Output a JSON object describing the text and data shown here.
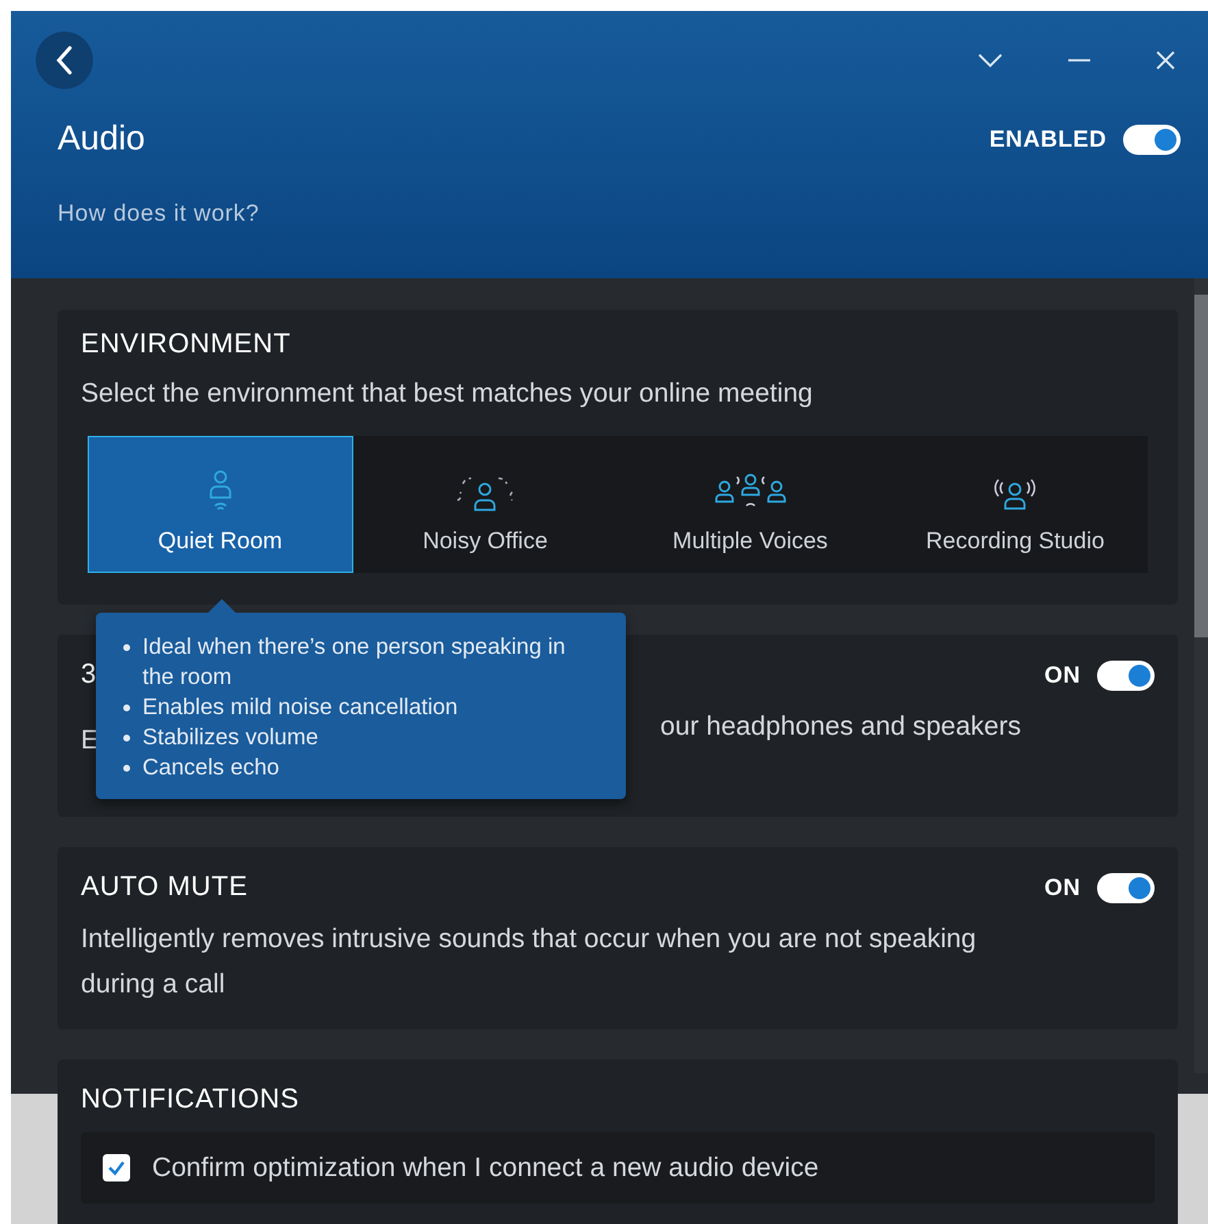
{
  "header": {
    "title": "Audio",
    "link": "How does it work?",
    "enabled": {
      "label": "ENABLED",
      "on": true
    }
  },
  "environment": {
    "title": "ENVIRONMENT",
    "description": "Select the environment that best matches your online meeting",
    "options": [
      {
        "label": "Quiet Room",
        "kind": "quiet",
        "selected": true
      },
      {
        "label": "Noisy Office",
        "kind": "noisy",
        "selected": false
      },
      {
        "label": "Multiple Voices",
        "kind": "multiple",
        "selected": false
      },
      {
        "label": "Recording Studio",
        "kind": "studio",
        "selected": false
      }
    ],
    "tooltip": [
      "Ideal when there’s one person speaking in the room",
      "Enables mild noise cancellation",
      "Stabilizes volume",
      "Cancels echo"
    ]
  },
  "settings": [
    {
      "title": "3",
      "description_start": "E",
      "description_end": "our headphones and speakers",
      "toggle": {
        "label": "ON",
        "on": true
      }
    },
    {
      "title": "AUTO MUTE",
      "description": "Intelligently removes intrusive sounds that occur when you are not speaking during a call",
      "toggle": {
        "label": "ON",
        "on": true
      }
    }
  ],
  "notifications": {
    "title": "NOTIFICATIONS",
    "items": [
      {
        "label": "Confirm optimization when I connect a new audio device",
        "checked": true
      }
    ]
  }
}
